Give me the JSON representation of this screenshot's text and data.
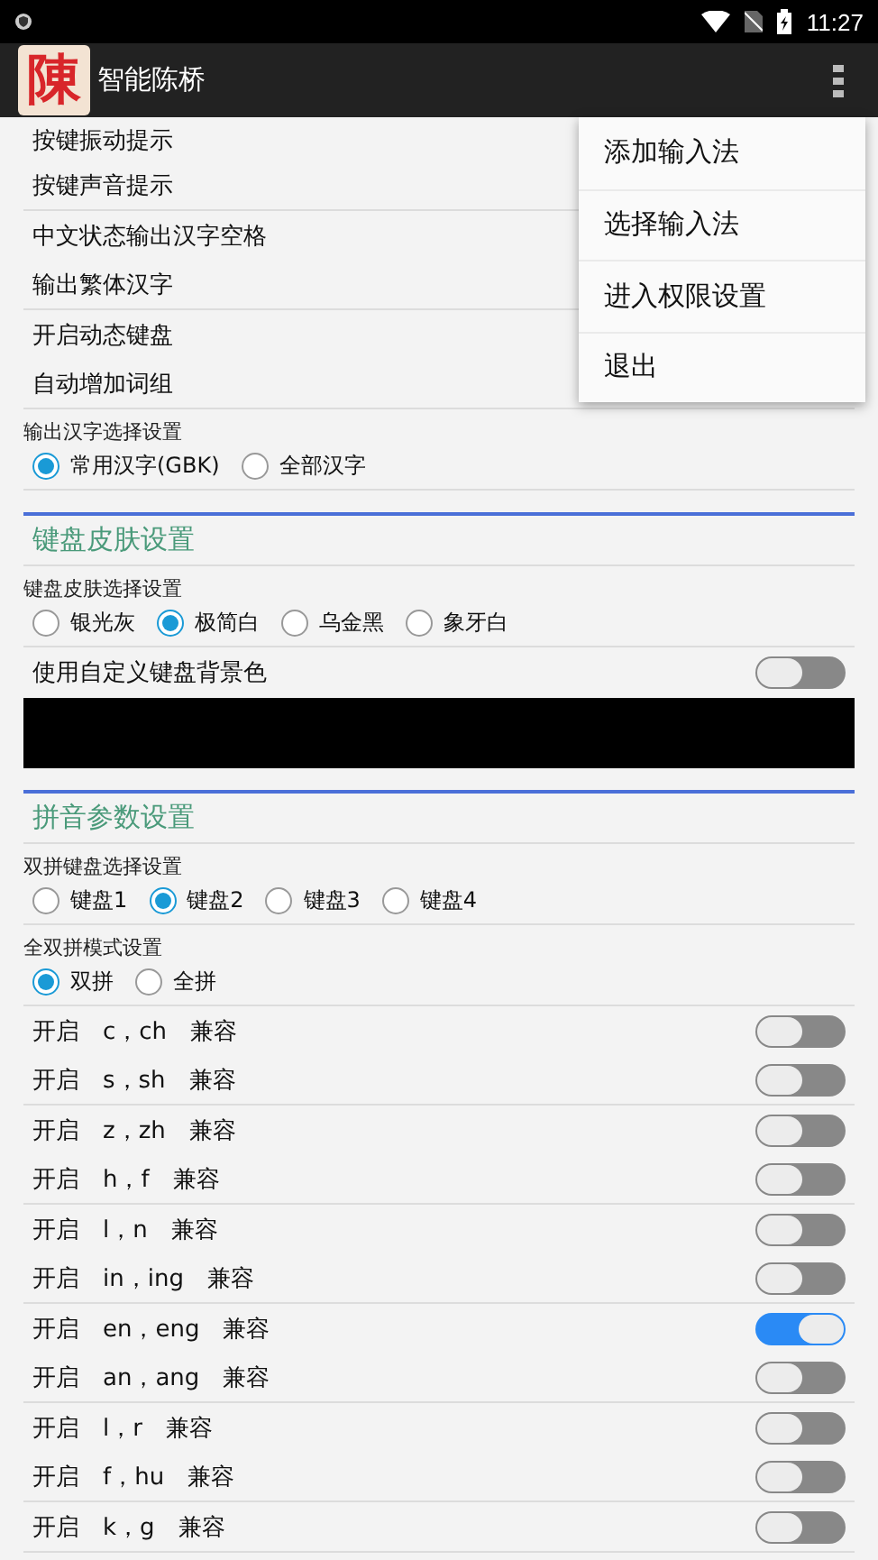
{
  "status_bar": {
    "time": "11:27"
  },
  "app_bar": {
    "icon_text": "陳",
    "title": "智能陈桥"
  },
  "groups": [
    {
      "kind": "toggles",
      "rows": [
        {
          "label": "按键振动提示"
        },
        {
          "label": "按键声音提示"
        }
      ]
    },
    {
      "kind": "toggles",
      "rows": [
        {
          "label": "中文状态输出汉字空格"
        },
        {
          "label": "输出繁体汉字"
        }
      ]
    },
    {
      "kind": "toggles",
      "rows": [
        {
          "label": "开启动态键盘"
        },
        {
          "label": "自动增加词组"
        }
      ]
    },
    {
      "kind": "radio",
      "label": "输出汉字选择设置",
      "options": [
        {
          "label": "常用汉字(GBK)",
          "selected": true
        },
        {
          "label": "全部汉字",
          "selected": false
        }
      ]
    },
    {
      "kind": "header",
      "title": "键盘皮肤设置"
    },
    {
      "kind": "radio",
      "label": "键盘皮肤选择设置",
      "options": [
        {
          "label": "银光灰",
          "selected": false
        },
        {
          "label": "极简白",
          "selected": true
        },
        {
          "label": "乌金黑",
          "selected": false
        },
        {
          "label": "象牙白",
          "selected": false
        }
      ]
    },
    {
      "kind": "swatch",
      "label": "使用自定义键盘背景色",
      "on": false,
      "color": "#000000"
    },
    {
      "kind": "header",
      "title": "拼音参数设置"
    },
    {
      "kind": "radio",
      "label": "双拼键盘选择设置",
      "options": [
        {
          "label": "键盘1",
          "selected": false
        },
        {
          "label": "键盘2",
          "selected": true
        },
        {
          "label": "键盘3",
          "selected": false
        },
        {
          "label": "键盘4",
          "selected": false
        }
      ]
    },
    {
      "kind": "radio",
      "label": "全双拼模式设置",
      "options": [
        {
          "label": "双拼",
          "selected": true
        },
        {
          "label": "全拼",
          "selected": false
        }
      ]
    },
    {
      "kind": "toggles",
      "rows": [
        {
          "label": "开启　c，ch　兼容",
          "on": false
        },
        {
          "label": "开启　s，sh　兼容",
          "on": false
        }
      ]
    },
    {
      "kind": "toggles",
      "rows": [
        {
          "label": "开启　z，zh　兼容",
          "on": false
        },
        {
          "label": "开启　h，f　兼容",
          "on": false
        }
      ]
    },
    {
      "kind": "toggles",
      "rows": [
        {
          "label": "开启　l，n　兼容",
          "on": false
        },
        {
          "label": "开启　in，ing　兼容",
          "on": false
        }
      ]
    },
    {
      "kind": "toggles",
      "rows": [
        {
          "label": "开启　en，eng　兼容",
          "on": true
        },
        {
          "label": "开启　an，ang　兼容",
          "on": false
        }
      ]
    },
    {
      "kind": "toggles",
      "rows": [
        {
          "label": "开启　l，r　兼容",
          "on": false
        },
        {
          "label": "开启　f，hu　兼容",
          "on": false
        }
      ]
    },
    {
      "kind": "toggles",
      "rows": [
        {
          "label": "开启　k，g　兼容",
          "on": false
        }
      ]
    }
  ],
  "menu": [
    {
      "label": "添加输入法"
    },
    {
      "label": "选择输入法"
    },
    {
      "label": "进入权限设置"
    },
    {
      "label": "退出"
    }
  ]
}
